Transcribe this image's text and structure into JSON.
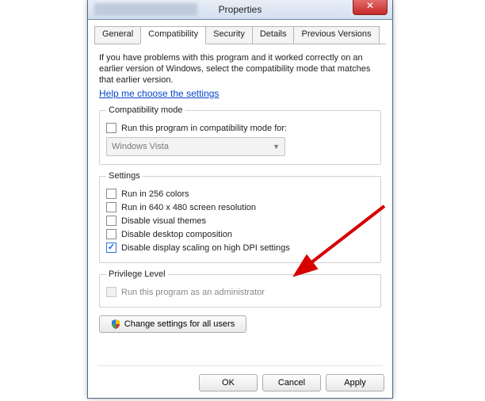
{
  "window": {
    "title": "Properties"
  },
  "close_glyph": "✕",
  "tabs": {
    "general": "General",
    "compatibility": "Compatibility",
    "security": "Security",
    "details": "Details",
    "previous": "Previous Versions"
  },
  "intro": "If you have problems with this program and it worked correctly on an earlier version of Windows, select the compatibility mode that matches that earlier version.",
  "help_link": "Help me choose the settings",
  "groups": {
    "compat_mode": {
      "legend": "Compatibility mode",
      "run_compat": "Run this program in compatibility mode for:",
      "os_selected": "Windows Vista"
    },
    "settings": {
      "legend": "Settings",
      "c256": "Run in 256 colors",
      "res640": "Run in 640 x 480 screen resolution",
      "visual_themes": "Disable visual themes",
      "desktop_comp": "Disable desktop composition",
      "high_dpi": "Disable display scaling on high DPI settings"
    },
    "privilege": {
      "legend": "Privilege Level",
      "run_admin": "Run this program as an administrator"
    }
  },
  "all_users_btn": "Change settings for all users",
  "footer": {
    "ok": "OK",
    "cancel": "Cancel",
    "apply": "Apply"
  }
}
